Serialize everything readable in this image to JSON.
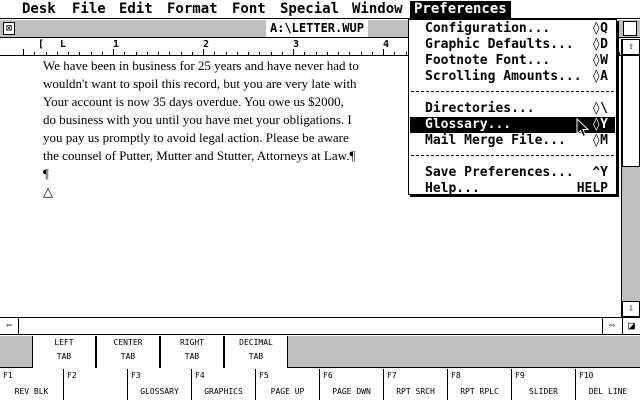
{
  "menubar": {
    "items": [
      "Desk",
      "File",
      "Edit",
      "Format",
      "Font",
      "Special",
      "Window",
      "Preferences"
    ],
    "active": "Preferences"
  },
  "window": {
    "title": "A:\\LETTER.WUP",
    "close_glyph": "⊠"
  },
  "ruler": {
    "numbers": [
      "1",
      "2",
      "3",
      "4"
    ],
    "left_margin": "[",
    "left_indent": "L"
  },
  "document": {
    "lines": [
      "We have been in business for 25 years and have never had to",
      "wouldn't want to spoil this record, but you are very late with",
      "Your account is now 35 days overdue.  You owe us $2000,",
      "do business with you until you have met your obligations.  I",
      "you pay us promptly to avoid legal action.  Please be aware",
      "the counsel of Putter, Mutter and Stutter, Attorneys at Law.¶",
      "¶",
      "△"
    ]
  },
  "preferences_menu": {
    "items": [
      {
        "label": "Configuration...",
        "shortcut": "◊Q"
      },
      {
        "label": "Graphic Defaults...",
        "shortcut": "◊D"
      },
      {
        "label": "Footnote Font...",
        "shortcut": "◊W"
      },
      {
        "label": "Scrolling Amounts...",
        "shortcut": "◊A"
      },
      {
        "label": "Directories...",
        "shortcut": "◊\\"
      },
      {
        "label": "Glossary...",
        "shortcut": "◊Y",
        "highlighted": true
      },
      {
        "label": "Mail Merge File...",
        "shortcut": "◊M"
      },
      {
        "label": "Save Preferences...",
        "shortcut": "^Y"
      },
      {
        "label": "Help...",
        "shortcut": "HELP"
      }
    ]
  },
  "tabs": [
    {
      "top": "LEFT",
      "bottom": "TAB"
    },
    {
      "top": "CENTER",
      "bottom": "TAB"
    },
    {
      "top": "RIGHT",
      "bottom": "TAB"
    },
    {
      "top": "DECIMAL",
      "bottom": "TAB"
    }
  ],
  "function_keys": [
    {
      "key": "F1",
      "label": "REV BLK"
    },
    {
      "key": "F2",
      "label": ""
    },
    {
      "key": "F3",
      "label": "GLOSSARY"
    },
    {
      "key": "F4",
      "label": "GRAPHICS"
    },
    {
      "key": "F5",
      "label": "PAGE UP"
    },
    {
      "key": "F6",
      "label": "PAGE DWN"
    },
    {
      "key": "F7",
      "label": "RPT SRCH"
    },
    {
      "key": "F8",
      "label": "RPT RPLC"
    },
    {
      "key": "F9",
      "label": "SLIDER"
    },
    {
      "key": "F10",
      "label": "DEL LINE"
    }
  ],
  "scroll_glyphs": {
    "up": "⇧",
    "down": "⇩",
    "left": "⇦",
    "right": "⇨"
  }
}
